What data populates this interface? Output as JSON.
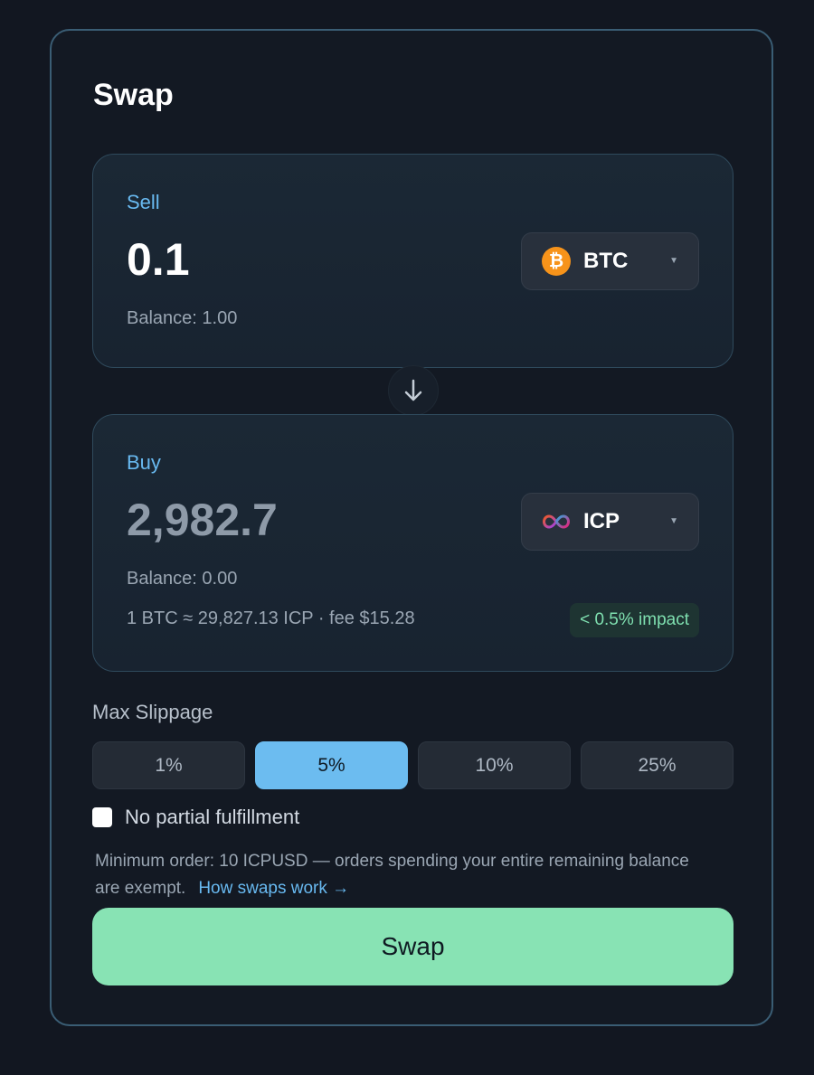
{
  "title": "Swap",
  "sell": {
    "label": "Sell",
    "amount": "0.1",
    "balance": "Balance: 1.00",
    "token": "BTC",
    "token_icon": "bitcoin-icon",
    "token_icon_glyph": "₿"
  },
  "buy": {
    "label": "Buy",
    "amount": "2,982.7",
    "balance": "Balance: 0.00",
    "token": "ICP",
    "token_icon": "internet-computer-icon",
    "rate": "1 BTC ≈ 29,827.13 ICP · fee $15.28",
    "impact": "< 0.5% impact"
  },
  "slippage": {
    "label": "Max Slippage",
    "options": [
      "1%",
      "5%",
      "10%",
      "25%"
    ],
    "selected": "5%"
  },
  "partial": {
    "label": "No partial fulfillment",
    "checked": false
  },
  "note": {
    "text": "Minimum order: 10 ICPUSD — orders spending your entire remaining balance are exempt.",
    "link": "How swaps work →"
  },
  "swap_button": "Swap",
  "colors": {
    "accent": "#68b9f0",
    "swap_button": "#88e3b4",
    "impact": "#7fe0b0",
    "btc": "#f7931a"
  }
}
